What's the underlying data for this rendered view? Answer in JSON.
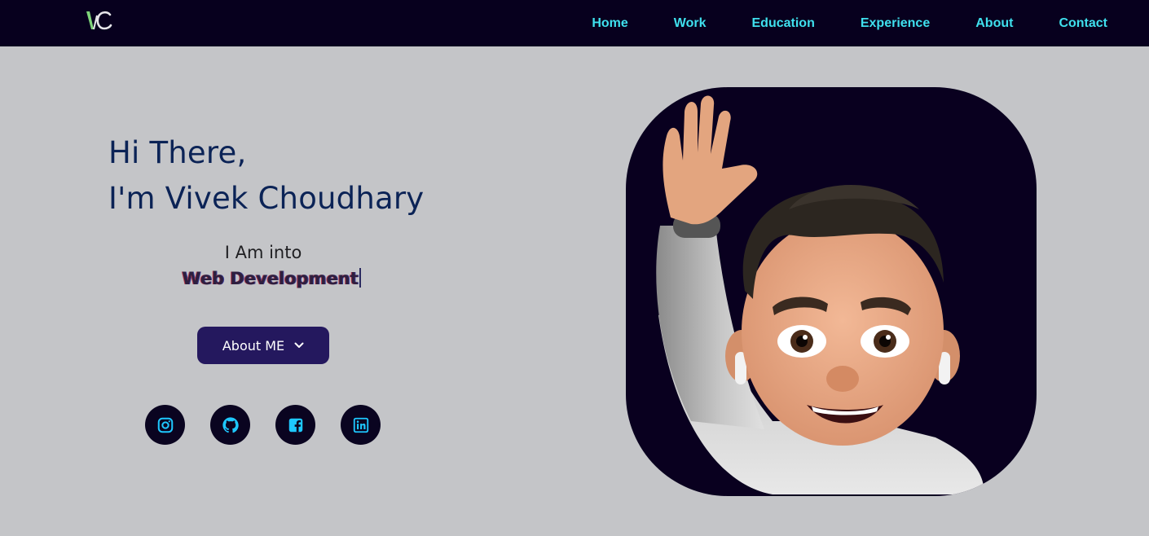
{
  "nav": {
    "logo_icon": "vc-logo-icon",
    "links": [
      "Home",
      "Work",
      "Education",
      "Experience",
      "About",
      "Contact"
    ]
  },
  "hero": {
    "greeting_line1": "Hi There,",
    "greeting_line2": "I'm Vivek Choudhary",
    "into_label": "I Am into",
    "typed_text": "Web Development",
    "about_button": "About ME",
    "about_button_icon": "chevron-down-icon",
    "socials": [
      "instagram-icon",
      "github-icon",
      "facebook-icon",
      "linkedin-icon"
    ],
    "avatar": "memoji-waving-avatar"
  },
  "colors": {
    "nav_bg": "#07001e",
    "nav_link": "#3fe0ee",
    "page_bg": "#c4c5c8",
    "heading": "#0b2356",
    "button_bg": "#24185e",
    "social_icon": "#1ec8ff"
  }
}
